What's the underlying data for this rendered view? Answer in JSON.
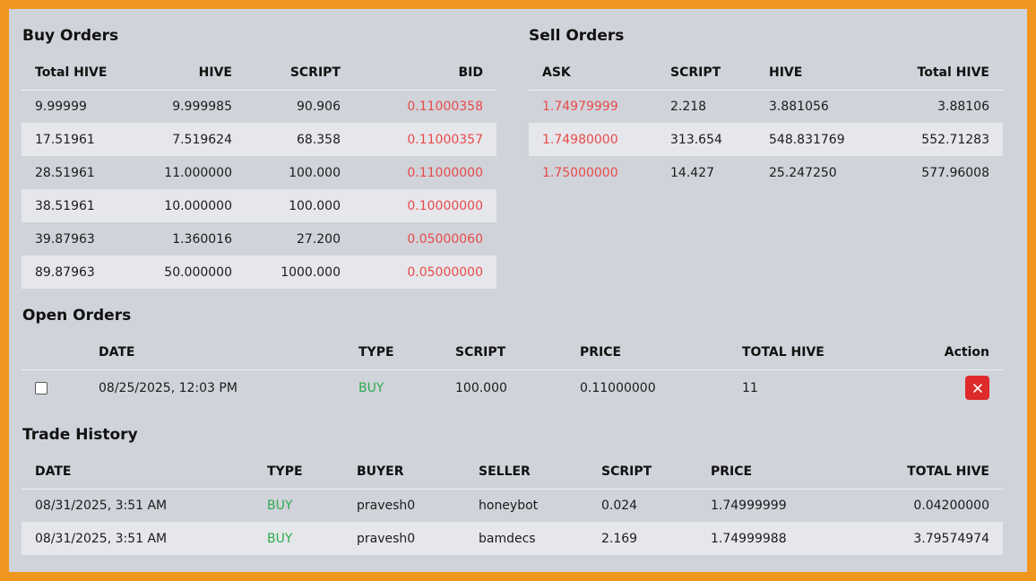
{
  "buy_orders": {
    "title": "Buy Orders",
    "headers": [
      "Total HIVE",
      "HIVE",
      "SCRIPT",
      "BID"
    ],
    "rows": [
      [
        "9.99999",
        "9.999985",
        "90.906",
        "0.11000358"
      ],
      [
        "17.51961",
        "7.519624",
        "68.358",
        "0.11000357"
      ],
      [
        "28.51961",
        "11.000000",
        "100.000",
        "0.11000000"
      ],
      [
        "38.51961",
        "10.000000",
        "100.000",
        "0.10000000"
      ],
      [
        "39.87963",
        "1.360016",
        "27.200",
        "0.05000060"
      ],
      [
        "89.87963",
        "50.000000",
        "1000.000",
        "0.05000000"
      ]
    ]
  },
  "sell_orders": {
    "title": "Sell Orders",
    "headers": [
      "ASK",
      "SCRIPT",
      "HIVE",
      "Total HIVE"
    ],
    "rows": [
      [
        "1.74979999",
        "2.218",
        "3.881056",
        "3.88106"
      ],
      [
        "1.74980000",
        "313.654",
        "548.831769",
        "552.71283"
      ],
      [
        "1.75000000",
        "14.427",
        "25.247250",
        "577.96008"
      ]
    ]
  },
  "open_orders": {
    "title": "Open Orders",
    "headers": [
      "",
      "DATE",
      "TYPE",
      "SCRIPT",
      "PRICE",
      "TOTAL HIVE",
      "Action"
    ],
    "rows": [
      [
        "08/25/2025, 12:03 PM",
        "BUY",
        "100.000",
        "0.11000000",
        "11"
      ]
    ],
    "delete_icon": "close-icon"
  },
  "trade_history": {
    "title": "Trade History",
    "headers": [
      "DATE",
      "TYPE",
      "BUYER",
      "SELLER",
      "SCRIPT",
      "PRICE",
      "TOTAL HIVE"
    ],
    "rows": [
      [
        "08/31/2025, 3:51 AM",
        "BUY",
        "pravesh0",
        "honeybot",
        "0.024",
        "1.74999999",
        "0.04200000"
      ],
      [
        "08/31/2025, 3:51 AM",
        "BUY",
        "pravesh0",
        "bamdecs",
        "2.169",
        "1.74999988",
        "3.79574974"
      ]
    ]
  },
  "colors": {
    "frame": "#f0961e",
    "panel": "#d0d3da",
    "row_alt": "#e6e7eb",
    "price_red": "#e84a4a",
    "buy_green": "#2dab4e",
    "delete_button": "#de2a2a"
  }
}
